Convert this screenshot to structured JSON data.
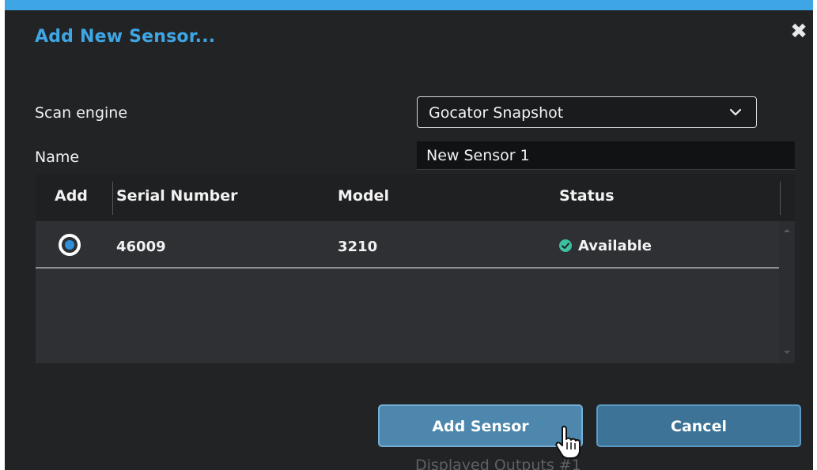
{
  "dialog": {
    "title": "Add New Sensor...",
    "close_icon": "close-icon",
    "accent_color": "#3fa6e5"
  },
  "form": {
    "scan_engine_label": "Scan engine",
    "scan_engine_value": "Gocator Snapshot",
    "name_label": "Name",
    "name_value": "New Sensor 1"
  },
  "table": {
    "columns": [
      "Add",
      "Serial Number",
      "Model",
      "Status"
    ],
    "rows": [
      {
        "selected": true,
        "serial_number": "46009",
        "model": "3210",
        "status": "Available",
        "status_icon": "check-circle-icon",
        "status_color": "#3dbfa0"
      }
    ]
  },
  "buttons": {
    "add_label": "Add Sensor",
    "cancel_label": "Cancel"
  },
  "background": {
    "partial_text": "Displayed Outputs #1"
  }
}
